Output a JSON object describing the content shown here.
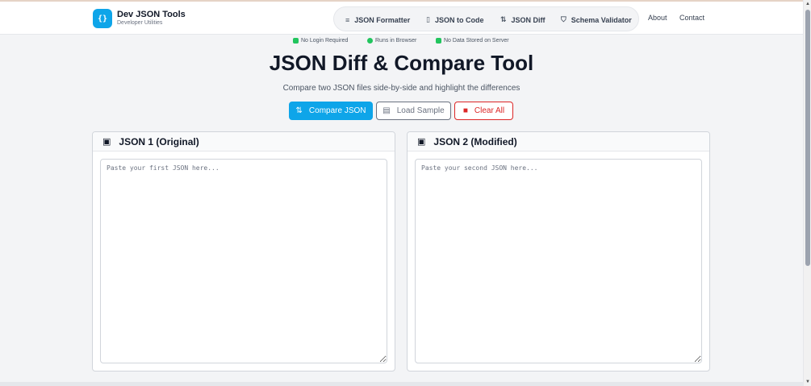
{
  "brand": {
    "logo_glyph": "{}",
    "title": "Dev JSON Tools",
    "subtitle": "Developer Utilities"
  },
  "nav": {
    "pill_items": [
      {
        "label": "JSON Formatter",
        "icon": "align-left-icon"
      },
      {
        "label": "JSON to Code",
        "icon": "file-code-icon"
      },
      {
        "label": "JSON Diff",
        "icon": "swap-icon"
      },
      {
        "label": "Schema Validator",
        "icon": "shield-icon"
      }
    ],
    "links": [
      "About",
      "Contact"
    ]
  },
  "features": [
    {
      "label": "No Login Required",
      "icon": "user-check-icon"
    },
    {
      "label": "Runs in Browser",
      "icon": "globe-icon"
    },
    {
      "label": "No Data Stored on Server",
      "icon": "database-icon"
    }
  ],
  "page": {
    "title": "JSON Diff & Compare Tool",
    "subtitle": "Compare two JSON files side-by-side and highlight the differences"
  },
  "actions": {
    "compare_label": "Compare JSON",
    "sample_label": "Load Sample",
    "clear_label": "Clear All"
  },
  "panels": {
    "left": {
      "title": "JSON 1 (Original)",
      "placeholder": "Paste your first JSON here...",
      "value": ""
    },
    "right": {
      "title": "JSON 2 (Modified)",
      "placeholder": "Paste your second JSON here...",
      "value": ""
    }
  },
  "colors": {
    "accent": "#0ea5e9",
    "danger": "#dc2626",
    "success": "#22c55e",
    "background": "#f3f4f6"
  }
}
